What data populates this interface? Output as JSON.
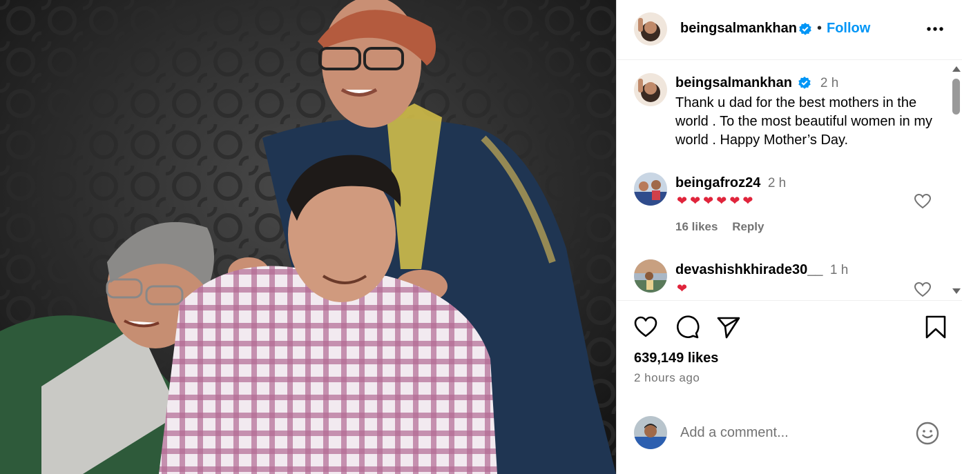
{
  "colors": {
    "accent": "#0095f6",
    "heart": "#e0243b",
    "muted": "#737373"
  },
  "post": {
    "author": "beingsalmankhan",
    "follow_label": "Follow",
    "separator": "•",
    "more_icon": "more-horizontal-icon"
  },
  "caption": {
    "username": "beingsalmankhan",
    "time": "2 h",
    "text": "Thank u dad for the best mothers in the world . To the most beautiful women in my world . Happy Mother’s Day."
  },
  "comments": [
    {
      "username": "beingafroz24",
      "time": "2 h",
      "text": "❤❤❤❤❤❤",
      "likes": "16 likes",
      "reply": "Reply"
    },
    {
      "username": "devashishkhirade30__",
      "time": "1 h",
      "text": "❤"
    }
  ],
  "actions": {
    "like_icon": "heart-icon",
    "comment_icon": "comment-icon",
    "share_icon": "send-icon",
    "save_icon": "bookmark-icon"
  },
  "likes_label": "639,149 likes",
  "posted_ago": "2 hours ago",
  "add_comment": {
    "placeholder": "Add a comment..."
  }
}
